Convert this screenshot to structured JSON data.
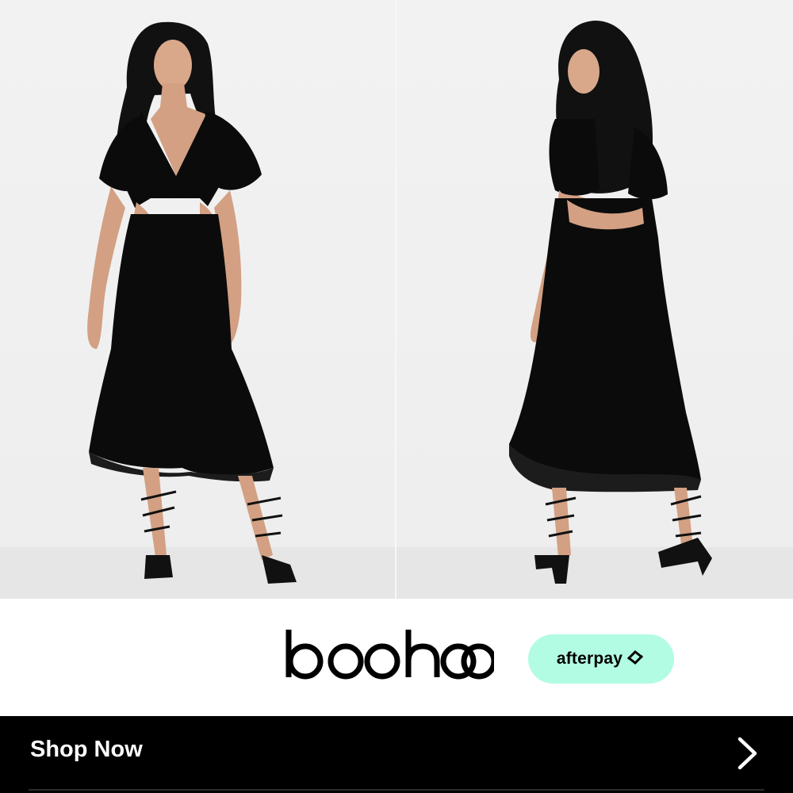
{
  "ad": {
    "brand_logo": "boohoo",
    "payment_badge": "afterpay",
    "cta_label": "Shop Now",
    "cta_icon": "chevron-right-icon"
  },
  "photo": {
    "views": [
      "front",
      "back"
    ],
    "dress_color": "#0b0b0b",
    "background_color": "#efefef"
  },
  "colors": {
    "afterpay_mint": "#b2fce4",
    "cta_background": "#000000",
    "cta_text": "#ffffff"
  }
}
